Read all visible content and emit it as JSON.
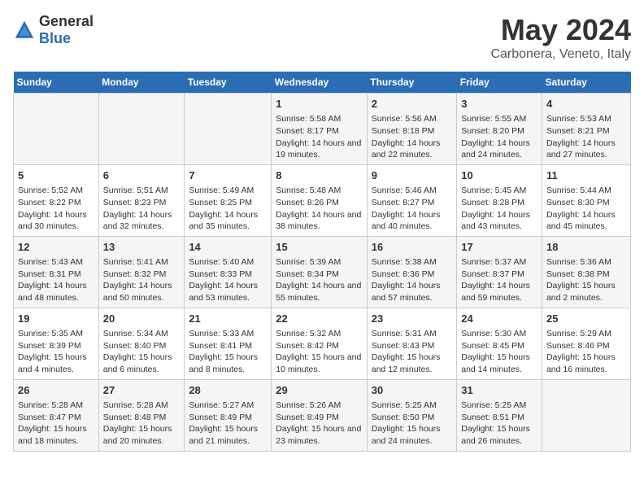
{
  "logo": {
    "general": "General",
    "blue": "Blue"
  },
  "title": "May 2024",
  "subtitle": "Carbonera, Veneto, Italy",
  "days_header": [
    "Sunday",
    "Monday",
    "Tuesday",
    "Wednesday",
    "Thursday",
    "Friday",
    "Saturday"
  ],
  "weeks": [
    [
      {
        "day": "",
        "sunrise": "",
        "sunset": "",
        "daylight": ""
      },
      {
        "day": "",
        "sunrise": "",
        "sunset": "",
        "daylight": ""
      },
      {
        "day": "",
        "sunrise": "",
        "sunset": "",
        "daylight": ""
      },
      {
        "day": "1",
        "sunrise": "Sunrise: 5:58 AM",
        "sunset": "Sunset: 8:17 PM",
        "daylight": "Daylight: 14 hours and 19 minutes."
      },
      {
        "day": "2",
        "sunrise": "Sunrise: 5:56 AM",
        "sunset": "Sunset: 8:18 PM",
        "daylight": "Daylight: 14 hours and 22 minutes."
      },
      {
        "day": "3",
        "sunrise": "Sunrise: 5:55 AM",
        "sunset": "Sunset: 8:20 PM",
        "daylight": "Daylight: 14 hours and 24 minutes."
      },
      {
        "day": "4",
        "sunrise": "Sunrise: 5:53 AM",
        "sunset": "Sunset: 8:21 PM",
        "daylight": "Daylight: 14 hours and 27 minutes."
      }
    ],
    [
      {
        "day": "5",
        "sunrise": "Sunrise: 5:52 AM",
        "sunset": "Sunset: 8:22 PM",
        "daylight": "Daylight: 14 hours and 30 minutes."
      },
      {
        "day": "6",
        "sunrise": "Sunrise: 5:51 AM",
        "sunset": "Sunset: 8:23 PM",
        "daylight": "Daylight: 14 hours and 32 minutes."
      },
      {
        "day": "7",
        "sunrise": "Sunrise: 5:49 AM",
        "sunset": "Sunset: 8:25 PM",
        "daylight": "Daylight: 14 hours and 35 minutes."
      },
      {
        "day": "8",
        "sunrise": "Sunrise: 5:48 AM",
        "sunset": "Sunset: 8:26 PM",
        "daylight": "Daylight: 14 hours and 38 minutes."
      },
      {
        "day": "9",
        "sunrise": "Sunrise: 5:46 AM",
        "sunset": "Sunset: 8:27 PM",
        "daylight": "Daylight: 14 hours and 40 minutes."
      },
      {
        "day": "10",
        "sunrise": "Sunrise: 5:45 AM",
        "sunset": "Sunset: 8:28 PM",
        "daylight": "Daylight: 14 hours and 43 minutes."
      },
      {
        "day": "11",
        "sunrise": "Sunrise: 5:44 AM",
        "sunset": "Sunset: 8:30 PM",
        "daylight": "Daylight: 14 hours and 45 minutes."
      }
    ],
    [
      {
        "day": "12",
        "sunrise": "Sunrise: 5:43 AM",
        "sunset": "Sunset: 8:31 PM",
        "daylight": "Daylight: 14 hours and 48 minutes."
      },
      {
        "day": "13",
        "sunrise": "Sunrise: 5:41 AM",
        "sunset": "Sunset: 8:32 PM",
        "daylight": "Daylight: 14 hours and 50 minutes."
      },
      {
        "day": "14",
        "sunrise": "Sunrise: 5:40 AM",
        "sunset": "Sunset: 8:33 PM",
        "daylight": "Daylight: 14 hours and 53 minutes."
      },
      {
        "day": "15",
        "sunrise": "Sunrise: 5:39 AM",
        "sunset": "Sunset: 8:34 PM",
        "daylight": "Daylight: 14 hours and 55 minutes."
      },
      {
        "day": "16",
        "sunrise": "Sunrise: 5:38 AM",
        "sunset": "Sunset: 8:36 PM",
        "daylight": "Daylight: 14 hours and 57 minutes."
      },
      {
        "day": "17",
        "sunrise": "Sunrise: 5:37 AM",
        "sunset": "Sunset: 8:37 PM",
        "daylight": "Daylight: 14 hours and 59 minutes."
      },
      {
        "day": "18",
        "sunrise": "Sunrise: 5:36 AM",
        "sunset": "Sunset: 8:38 PM",
        "daylight": "Daylight: 15 hours and 2 minutes."
      }
    ],
    [
      {
        "day": "19",
        "sunrise": "Sunrise: 5:35 AM",
        "sunset": "Sunset: 8:39 PM",
        "daylight": "Daylight: 15 hours and 4 minutes."
      },
      {
        "day": "20",
        "sunrise": "Sunrise: 5:34 AM",
        "sunset": "Sunset: 8:40 PM",
        "daylight": "Daylight: 15 hours and 6 minutes."
      },
      {
        "day": "21",
        "sunrise": "Sunrise: 5:33 AM",
        "sunset": "Sunset: 8:41 PM",
        "daylight": "Daylight: 15 hours and 8 minutes."
      },
      {
        "day": "22",
        "sunrise": "Sunrise: 5:32 AM",
        "sunset": "Sunset: 8:42 PM",
        "daylight": "Daylight: 15 hours and 10 minutes."
      },
      {
        "day": "23",
        "sunrise": "Sunrise: 5:31 AM",
        "sunset": "Sunset: 8:43 PM",
        "daylight": "Daylight: 15 hours and 12 minutes."
      },
      {
        "day": "24",
        "sunrise": "Sunrise: 5:30 AM",
        "sunset": "Sunset: 8:45 PM",
        "daylight": "Daylight: 15 hours and 14 minutes."
      },
      {
        "day": "25",
        "sunrise": "Sunrise: 5:29 AM",
        "sunset": "Sunset: 8:46 PM",
        "daylight": "Daylight: 15 hours and 16 minutes."
      }
    ],
    [
      {
        "day": "26",
        "sunrise": "Sunrise: 5:28 AM",
        "sunset": "Sunset: 8:47 PM",
        "daylight": "Daylight: 15 hours and 18 minutes."
      },
      {
        "day": "27",
        "sunrise": "Sunrise: 5:28 AM",
        "sunset": "Sunset: 8:48 PM",
        "daylight": "Daylight: 15 hours and 20 minutes."
      },
      {
        "day": "28",
        "sunrise": "Sunrise: 5:27 AM",
        "sunset": "Sunset: 8:49 PM",
        "daylight": "Daylight: 15 hours and 21 minutes."
      },
      {
        "day": "29",
        "sunrise": "Sunrise: 5:26 AM",
        "sunset": "Sunset: 8:49 PM",
        "daylight": "Daylight: 15 hours and 23 minutes."
      },
      {
        "day": "30",
        "sunrise": "Sunrise: 5:25 AM",
        "sunset": "Sunset: 8:50 PM",
        "daylight": "Daylight: 15 hours and 24 minutes."
      },
      {
        "day": "31",
        "sunrise": "Sunrise: 5:25 AM",
        "sunset": "Sunset: 8:51 PM",
        "daylight": "Daylight: 15 hours and 26 minutes."
      },
      {
        "day": "",
        "sunrise": "",
        "sunset": "",
        "daylight": ""
      }
    ]
  ]
}
